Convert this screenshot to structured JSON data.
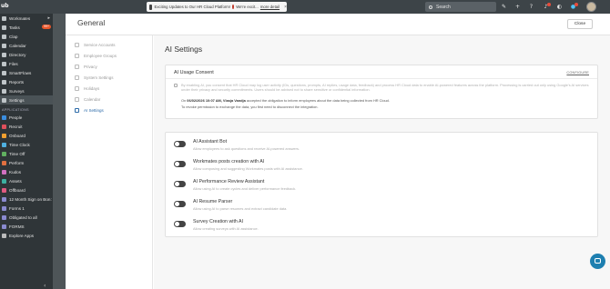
{
  "topbar": {
    "logo": "ub",
    "banner_text": "Exciting Updates to Our HR Cloud Platform!",
    "banner_suffix": "We're excit...",
    "banner_link": "more detail",
    "banner_close": "×",
    "search_label": "Search",
    "icons": [
      "pen-icon",
      "plus-icon",
      "help-icon",
      "bell-icon",
      "moon-icon",
      "color-icon",
      "avatar"
    ],
    "colors": {
      "bar": "#3d4448",
      "sidebar": "#2f3538",
      "accent": "#2b6aa8",
      "badge": "#e8562a"
    }
  },
  "sidebar": {
    "items": [
      {
        "label": "Workmates",
        "icon": "people-icon",
        "arrow": "▸"
      },
      {
        "label": "Tasks",
        "icon": "tasks-icon",
        "badge": "99+"
      },
      {
        "label": "Clap",
        "icon": "clap-icon"
      },
      {
        "label": "Calendar",
        "icon": "calendar-icon"
      },
      {
        "label": "Directory",
        "icon": "directory-icon"
      },
      {
        "label": "Files",
        "icon": "files-icon"
      },
      {
        "label": "SmartFlows",
        "icon": "flow-icon"
      },
      {
        "label": "Reports",
        "icon": "reports-icon"
      },
      {
        "label": "Surveys",
        "icon": "survey-icon"
      },
      {
        "label": "Settings",
        "icon": "gear-icon",
        "active": true
      }
    ],
    "section_label": "APPLICATIONS",
    "apps": [
      {
        "label": "People",
        "icon": "people-app-icon"
      },
      {
        "label": "Recruit",
        "icon": "recruit-icon"
      },
      {
        "label": "Onboard",
        "icon": "onboard-icon"
      },
      {
        "label": "Time Clock",
        "icon": "clock-icon"
      },
      {
        "label": "Time Off",
        "icon": "timeoff-icon"
      },
      {
        "label": "Perform",
        "icon": "perform-icon"
      },
      {
        "label": "Kudos",
        "icon": "kudos-icon"
      },
      {
        "label": "Assets",
        "icon": "assets-icon"
      },
      {
        "label": "Offboard",
        "icon": "offboard-icon"
      },
      {
        "label": "12 Month Sign on Bon:",
        "icon": "form-icon"
      },
      {
        "label": "Forms 1",
        "icon": "form-icon"
      },
      {
        "label": "Obligated to all",
        "icon": "form-icon"
      },
      {
        "label": "FORMS",
        "icon": "form-icon"
      },
      {
        "label": "Explore Apps",
        "icon": "grid-icon"
      }
    ],
    "collapse": "‹"
  },
  "main": {
    "title": "General",
    "close_label": "Close",
    "nav": [
      {
        "label": "Service Accounts"
      },
      {
        "label": "Employee Groups"
      },
      {
        "label": "Privacy"
      },
      {
        "label": "System Settings"
      },
      {
        "label": "Holidays"
      },
      {
        "label": "Calendar"
      },
      {
        "label": "AI Settings",
        "active": true
      }
    ],
    "heading": "AI Settings",
    "consent_card": {
      "title": "AI Usage Consent",
      "configure": "CONFIGURE",
      "consent_text": "By enabling AI, you consent that HR Cloud may log user activity (IDs, questions, prompts, AI replies, usage data, feedback) and process HR Cloud data to enable AI-powered features across the platform. Processing is carried out only using Google's AI services under their privacy and security commitments. Users should be advised not to share sensitive or confidential information.",
      "accepted_prefix": "On ",
      "accepted_date": "06/02/2026 10:07 AM, Vlasja Vandja",
      "accepted_suffix": " accepted the obligation to inform employees about the data being collected from HR Cloud.",
      "revoke_text": "To revoke permission to exchange the data, you first need to disconnect the integration."
    },
    "features": [
      {
        "name": "AI Assistant Bot",
        "desc": "Allow employees to ask questions and receive AI-powered answers.",
        "enabled": false
      },
      {
        "name": "Workmates posts creation with AI",
        "desc": "Allow composing and suggesting Workmates posts with AI assistance.",
        "enabled": false
      },
      {
        "name": "AI Performance Review Assistant",
        "desc": "Allow using AI to create cycles and deliver performance feedback.",
        "enabled": false
      },
      {
        "name": "AI Resume Parser",
        "desc": "Allow using AI to parse resumes and extract candidate data.",
        "enabled": false
      },
      {
        "name": "Survey Creation with AI",
        "desc": "Allow creating surveys with AI assistance.",
        "enabled": false
      }
    ]
  }
}
